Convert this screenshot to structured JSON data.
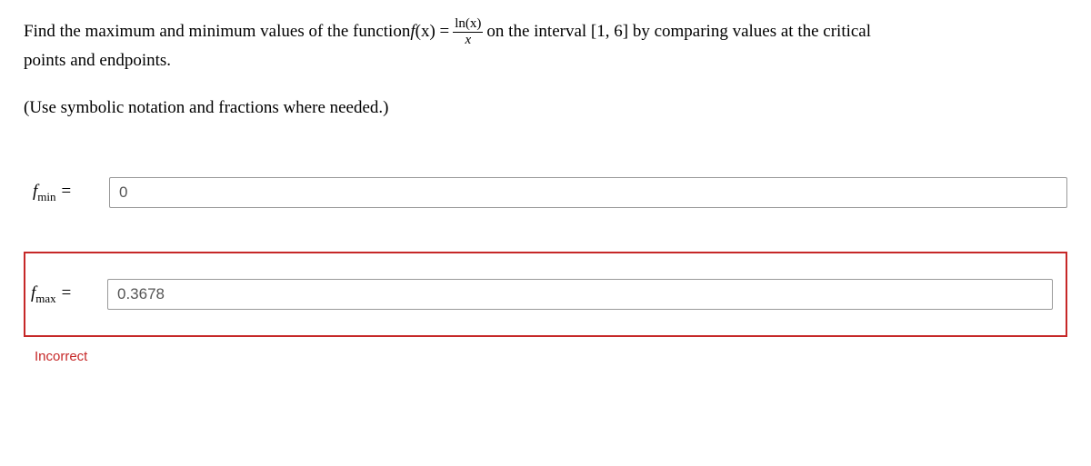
{
  "prompt": {
    "part1": "Find the maximum and minimum values of the function ",
    "func_lhs_f": "f",
    "func_lhs_paren_x": "(x) = ",
    "frac_num": "ln(x)",
    "frac_den": "x",
    "part2": " on the interval [1, 6] by comparing values at the critical",
    "part3": "points and endpoints."
  },
  "hint": "(Use symbolic notation and fractions where needed.)",
  "answers": {
    "fmin": {
      "label_f": "f",
      "label_sub": "min",
      "label_eq": " = ",
      "value": "0"
    },
    "fmax": {
      "label_f": "f",
      "label_sub": "max",
      "label_eq": " = ",
      "value": "0.3678"
    }
  },
  "feedback": {
    "incorrect": "Incorrect"
  }
}
